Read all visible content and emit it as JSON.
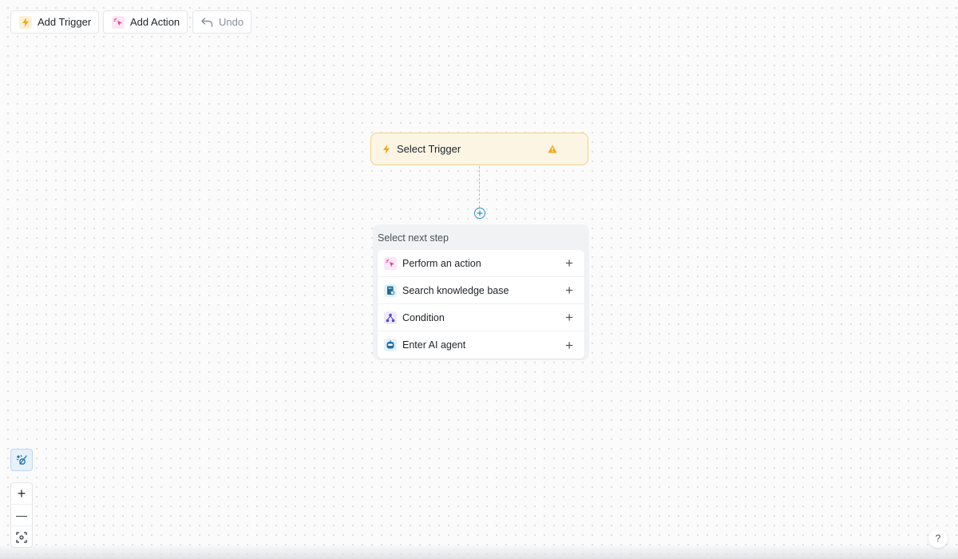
{
  "toolbar": {
    "add_trigger": {
      "label": "Add Trigger",
      "icon": "lightning-icon"
    },
    "add_action": {
      "label": "Add Action",
      "icon": "sparkle-cursor-icon"
    },
    "undo": {
      "label": "Undo",
      "icon": "undo-icon",
      "disabled": true
    }
  },
  "trigger_node": {
    "label": "Select Trigger",
    "icon": "lightning-icon",
    "status_icon": "warning-icon"
  },
  "next_step_panel": {
    "title": "Select next step",
    "options": [
      {
        "label": "Perform an action",
        "icon": "sparkle-cursor-icon",
        "action": "+"
      },
      {
        "label": "Search knowledge base",
        "icon": "knowledge-base-icon",
        "action": "+"
      },
      {
        "label": "Condition",
        "icon": "condition-icon",
        "action": "+"
      },
      {
        "label": "Enter AI agent",
        "icon": "ai-agent-icon",
        "action": "+"
      }
    ]
  },
  "canvas_controls": {
    "tidy": "tidy-layout-icon",
    "zoom_in": "+",
    "zoom_out": "—",
    "fit_view": "fit-view-icon"
  },
  "help": {
    "label": "?"
  },
  "colors": {
    "trigger_bg": "#fdf5e4",
    "trigger_border": "#f3cf86",
    "warning": "#f0a818",
    "accent_blue": "#2a8ccf",
    "action_pink": "#e0399a"
  }
}
